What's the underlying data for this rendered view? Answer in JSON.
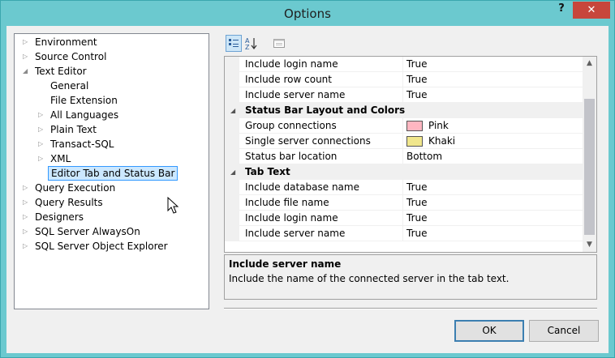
{
  "window": {
    "title": "Options",
    "help_label": "?",
    "close_label": "✕"
  },
  "tree": {
    "items": [
      {
        "label": "Environment",
        "expander": "collapsed",
        "level": 0
      },
      {
        "label": "Source Control",
        "expander": "collapsed",
        "level": 0
      },
      {
        "label": "Text Editor",
        "expander": "expanded",
        "level": 0
      },
      {
        "label": "General",
        "expander": "none",
        "level": 1
      },
      {
        "label": "File Extension",
        "expander": "none",
        "level": 1
      },
      {
        "label": "All Languages",
        "expander": "collapsed",
        "level": 1
      },
      {
        "label": "Plain Text",
        "expander": "collapsed",
        "level": 1
      },
      {
        "label": "Transact-SQL",
        "expander": "collapsed",
        "level": 1
      },
      {
        "label": "XML",
        "expander": "collapsed",
        "level": 1
      },
      {
        "label": "Editor Tab and Status Bar",
        "expander": "none",
        "level": 1,
        "selected": true
      },
      {
        "label": "Query Execution",
        "expander": "collapsed",
        "level": 0
      },
      {
        "label": "Query Results",
        "expander": "collapsed",
        "level": 0
      },
      {
        "label": "Designers",
        "expander": "collapsed",
        "level": 0
      },
      {
        "label": "SQL Server AlwaysOn",
        "expander": "collapsed",
        "level": 0
      },
      {
        "label": "SQL Server Object Explorer",
        "expander": "collapsed",
        "level": 0
      }
    ]
  },
  "toolbar": {
    "categorized_icon": "categorized-icon",
    "alphabetical_icon": "alphabetical-icon",
    "property_pages_icon": "property-pages-icon"
  },
  "grid": {
    "rows": [
      {
        "type": "property",
        "name": "Include login name",
        "value": "True"
      },
      {
        "type": "property",
        "name": "Include row count",
        "value": "True"
      },
      {
        "type": "property",
        "name": "Include server name",
        "value": "True"
      },
      {
        "type": "category",
        "name": "Status Bar Layout and Colors"
      },
      {
        "type": "property",
        "name": "Group connections",
        "value": "Pink",
        "swatch": "#ffb6c1"
      },
      {
        "type": "property",
        "name": "Single server connections",
        "value": "Khaki",
        "swatch": "#f0e68c"
      },
      {
        "type": "property",
        "name": "Status bar location",
        "value": "Bottom"
      },
      {
        "type": "category",
        "name": "Tab Text"
      },
      {
        "type": "property",
        "name": "Include database name",
        "value": "True"
      },
      {
        "type": "property",
        "name": "Include file name",
        "value": "True"
      },
      {
        "type": "property",
        "name": "Include login name",
        "value": "True"
      },
      {
        "type": "property",
        "name": "Include server name",
        "value": "True"
      }
    ]
  },
  "description": {
    "title": "Include server name",
    "text": "Include the name of the connected server in the tab text."
  },
  "buttons": {
    "ok": "OK",
    "cancel": "Cancel"
  },
  "colors": {
    "title_bar": "#6bc9cf",
    "close_button": "#c7463c",
    "selection": "#cce8ff"
  }
}
